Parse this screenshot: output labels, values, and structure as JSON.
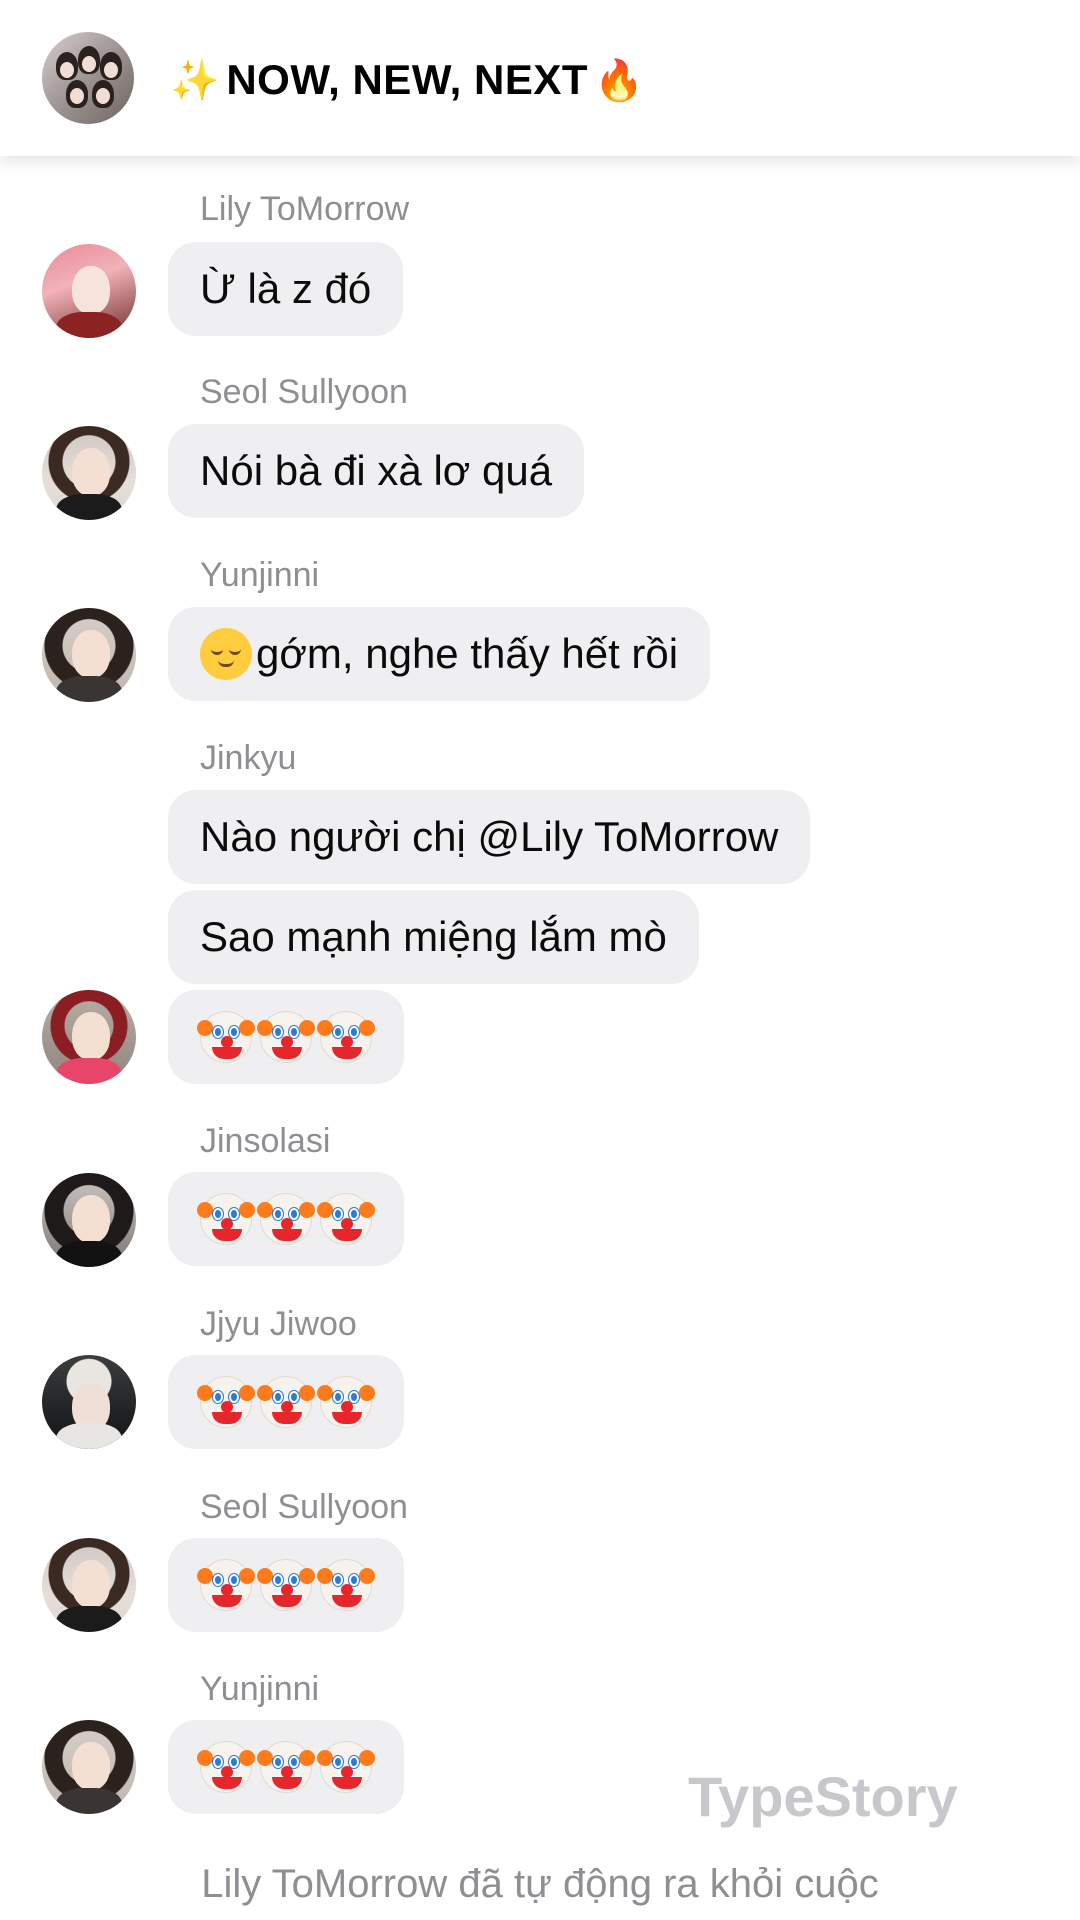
{
  "chat": {
    "title": "NOW, NEW, NEXT",
    "title_prefix_icon": "sparkles-icon",
    "title_suffix_icon": "fire-icon"
  },
  "messages": [
    {
      "sender": "Lily ToMorrow",
      "bubbles": [
        "Ừ là z đó"
      ]
    },
    {
      "sender": "Seol Sullyoon",
      "bubbles": [
        "Nói bà đi xà lơ quá"
      ]
    },
    {
      "sender": "Yunjinni",
      "bubbles": [
        "gớm, nghe thấy hết rồi"
      ],
      "leading_icon": "relieved-face-icon"
    },
    {
      "sender": "Jinkyu",
      "bubbles": [
        "Nào người chị @Lily ToMorrow",
        "Sao mạnh miệng lắm mò",
        "🤡🤡🤡"
      ]
    },
    {
      "sender": "Jinsolasi",
      "bubbles": [
        "🤡🤡🤡"
      ]
    },
    {
      "sender": "Jjyu Jiwoo",
      "bubbles": [
        "🤡🤡🤡"
      ]
    },
    {
      "sender": "Seol Sullyoon",
      "bubbles": [
        "🤡🤡🤡"
      ]
    },
    {
      "sender": "Yunjinni",
      "bubbles": [
        "🤡🤡🤡"
      ]
    }
  ],
  "watermark": "TypeStory",
  "system_message": "Lily ToMorrow đã tự động ra khỏi cuộc"
}
